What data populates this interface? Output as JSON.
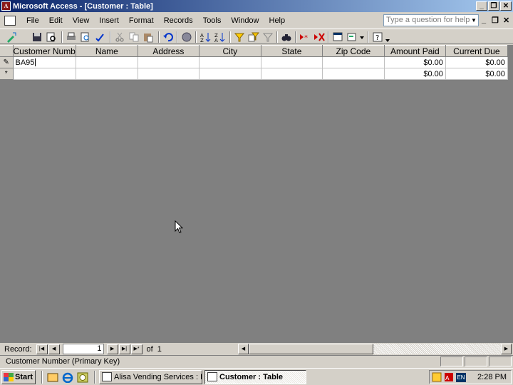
{
  "window": {
    "title": "Microsoft Access - [Customer : Table]",
    "controls": [
      "_",
      "❐",
      "✕"
    ]
  },
  "menubar": {
    "items": [
      "File",
      "Edit",
      "View",
      "Insert",
      "Format",
      "Records",
      "Tools",
      "Window",
      "Help"
    ],
    "help_placeholder": "Type a question for help",
    "mdi_controls": [
      "_",
      "❐",
      "✕"
    ]
  },
  "toolbar": {
    "icons": [
      "view-design-icon",
      "save-icon",
      "search-icon",
      "print-icon",
      "print-preview-icon",
      "spelling-icon",
      "cut-icon",
      "copy-icon",
      "paste-icon",
      "undo-icon",
      "hyperlink-icon",
      "sort-ascending-icon",
      "sort-descending-icon",
      "filter-by-selection-icon",
      "filter-by-form-icon",
      "apply-filter-icon",
      "find-icon",
      "new-record-icon",
      "delete-record-icon",
      "database-window-icon",
      "new-object-icon",
      "help-icon"
    ]
  },
  "datasheet": {
    "columns": [
      "Customer Numb",
      "Name",
      "Address",
      "City",
      "State",
      "Zip Code",
      "Amount Paid",
      "Current Due"
    ],
    "rows": [
      {
        "selector": "✎",
        "cells": [
          "BA95",
          "",
          "",
          "",
          "",
          "",
          "$0.00",
          "$0.00"
        ]
      },
      {
        "selector": "*",
        "cells": [
          "",
          "",
          "",
          "",
          "",
          "",
          "$0.00",
          "$0.00"
        ]
      }
    ]
  },
  "navigator": {
    "label": "Record:",
    "current": "1",
    "of_label": "of",
    "total": "1"
  },
  "statusbar": {
    "text": "Customer Number (Primary Key)"
  },
  "taskbar": {
    "start_label": "Start",
    "tasks": [
      {
        "label": "Alisa Vending Services : D...",
        "active": false
      },
      {
        "label": "Customer : Table",
        "active": true
      }
    ],
    "clock": "2:28 PM",
    "tray_lang": "EN"
  }
}
